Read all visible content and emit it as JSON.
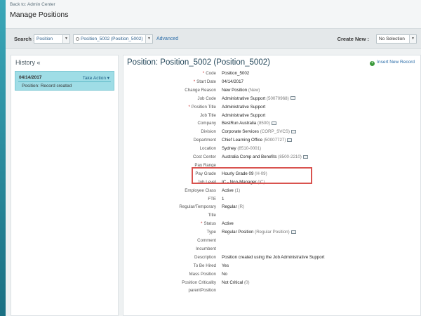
{
  "header": {
    "back_link": "Back to: Admin Center",
    "title": "Manage Positions"
  },
  "search": {
    "label": "Search :",
    "entity": "Position",
    "value": "Position_5002 (Position_5002)",
    "advanced": "Advanced",
    "create_label": "Create New :",
    "create_value": "No Selection"
  },
  "history": {
    "title": "History «",
    "date": "04/14/2017",
    "action": "Take Action ▾",
    "description": "Position: Record created"
  },
  "position": {
    "title": "Position: Position_5002 (Position_5002)",
    "insert": "Insert New Record",
    "fields": [
      {
        "label": "Code",
        "required": true,
        "value": "Position_5002",
        "sub": "",
        "icon": false
      },
      {
        "label": "Start Date",
        "required": true,
        "value": "04/14/2017",
        "sub": "",
        "icon": false
      },
      {
        "label": "Change Reason",
        "required": false,
        "value": "New Position",
        "sub": "(New)",
        "icon": false
      },
      {
        "label": "Job Code",
        "required": false,
        "value": "Administrative Support",
        "sub": "(50070968)",
        "icon": true
      },
      {
        "label": "Position Title",
        "required": true,
        "value": "Administrative Support",
        "sub": "",
        "icon": false
      },
      {
        "label": "Job Title",
        "required": false,
        "value": "Administrative Support",
        "sub": "",
        "icon": false
      },
      {
        "label": "Company",
        "required": false,
        "value": "BestRun Australia",
        "sub": "(8500)",
        "icon": true
      },
      {
        "label": "Division",
        "required": false,
        "value": "Corporate Services",
        "sub": "(CORP_SVCS)",
        "icon": true
      },
      {
        "label": "Department",
        "required": false,
        "value": "Chief Learning Office",
        "sub": "(50007727)",
        "icon": true
      },
      {
        "label": "Location",
        "required": false,
        "value": "Sydney",
        "sub": "(8510-0001)",
        "icon": false
      },
      {
        "label": "Cost Center",
        "required": false,
        "value": "Australia Comp and Benefits",
        "sub": "(8500-2210)",
        "icon": true
      },
      {
        "label": "Pay Range",
        "required": false,
        "value": "",
        "sub": "",
        "icon": false
      },
      {
        "label": "Pay Grade",
        "required": false,
        "value": "Hourly Grade 09",
        "sub": "(H-09)",
        "icon": false
      },
      {
        "label": "Job Level",
        "required": false,
        "value": "IC - Non-Manager",
        "sub": "(IC)",
        "icon": false
      },
      {
        "label": "Employee Class",
        "required": false,
        "value": "Active",
        "sub": "(1)",
        "icon": false
      },
      {
        "label": "FTE",
        "required": false,
        "value": "1",
        "sub": "",
        "icon": false
      },
      {
        "label": "Regular/Temporary",
        "required": false,
        "value": "Regular",
        "sub": "(R)",
        "icon": false
      },
      {
        "label": "Title",
        "required": false,
        "value": "",
        "sub": "",
        "icon": false
      },
      {
        "label": "Status",
        "required": true,
        "value": "Active",
        "sub": "",
        "icon": false
      },
      {
        "label": "Type",
        "required": false,
        "value": "Regular Position",
        "sub": "(Regular Position)",
        "icon": true
      },
      {
        "label": "Comment",
        "required": false,
        "value": "",
        "sub": "",
        "icon": false
      },
      {
        "label": "Incumbent",
        "required": false,
        "value": "",
        "sub": "",
        "icon": false
      },
      {
        "label": "Description",
        "required": false,
        "value": "Position created using the Job Administrative Support",
        "sub": "",
        "icon": false
      },
      {
        "label": "To Be Hired",
        "required": false,
        "value": "Yes",
        "sub": "",
        "icon": false
      },
      {
        "label": "Mass Position",
        "required": false,
        "value": "No",
        "sub": "",
        "icon": false
      },
      {
        "label": "Position Criticality",
        "required": false,
        "value": "Not Critical",
        "sub": "(0)",
        "icon": false
      },
      {
        "label": "parentPosition",
        "required": false,
        "value": "",
        "sub": "",
        "icon": false
      }
    ]
  },
  "colors": {
    "accent": "#3aa7b8",
    "highlight": "#d9534f",
    "history_card": "#9fdde6"
  }
}
